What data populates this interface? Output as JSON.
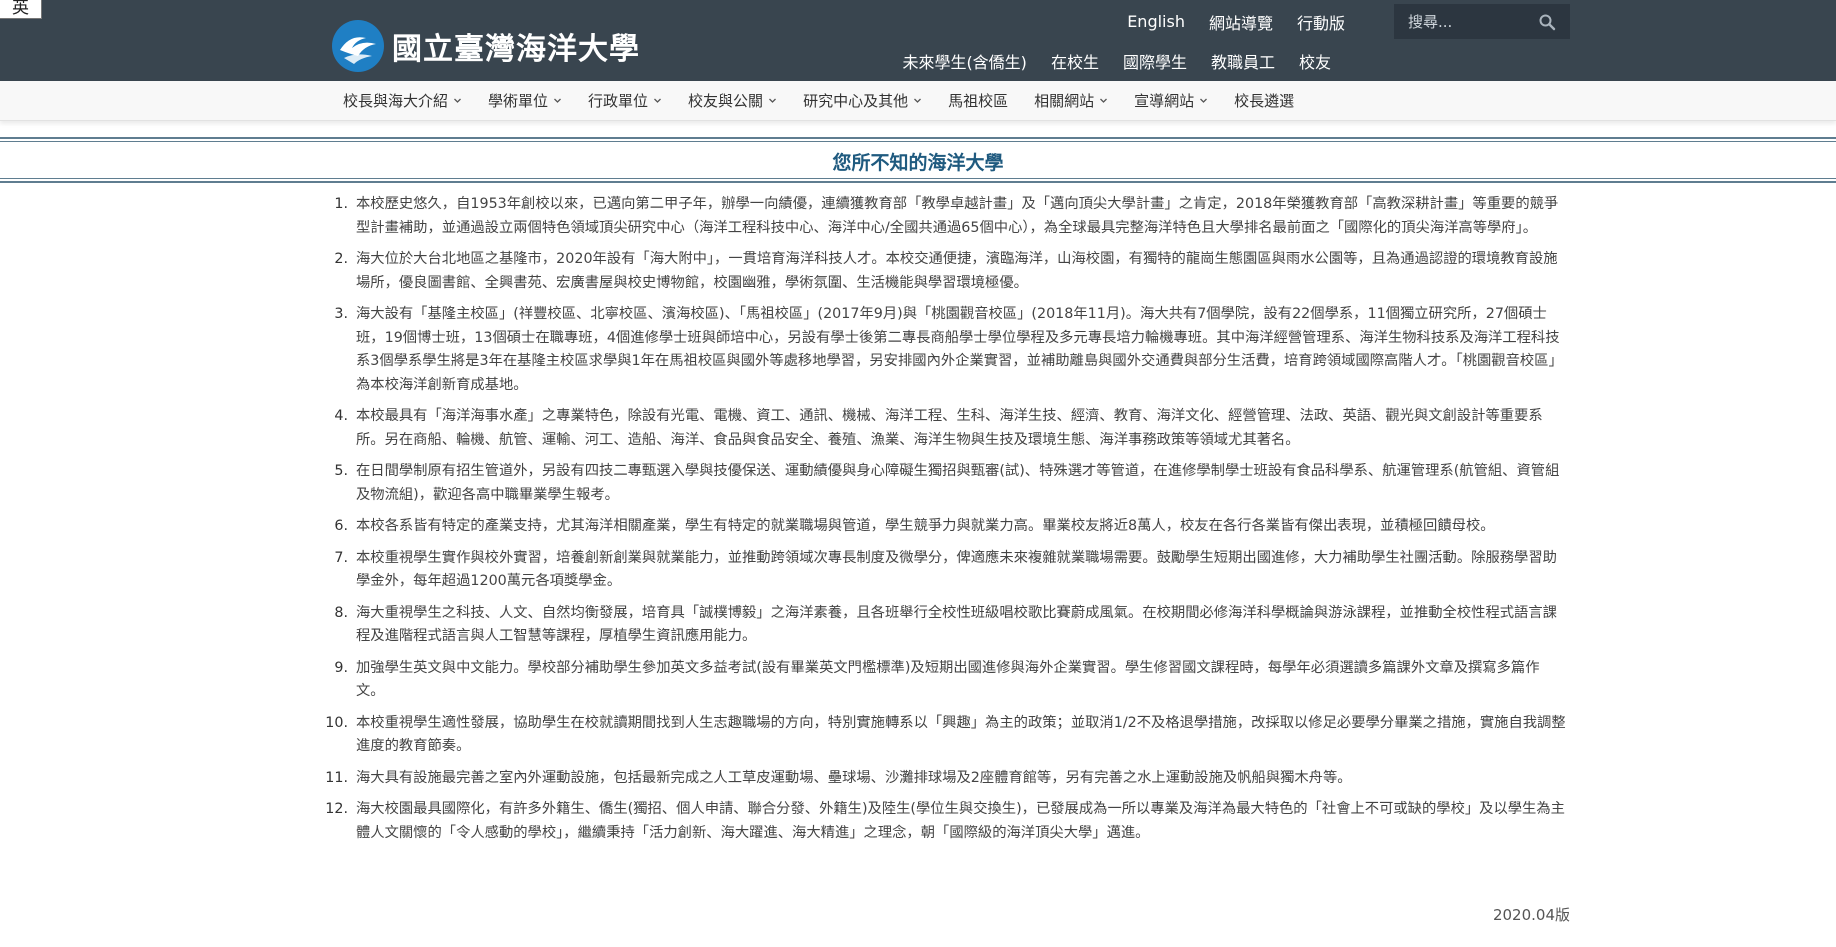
{
  "corner_badge": "英",
  "logo": {
    "text": "國立臺灣海洋大學"
  },
  "top_links": [
    "English",
    "網站導覽",
    "行動版"
  ],
  "search": {
    "placeholder": "搜尋..."
  },
  "role_links": [
    "未來學生(含僑生)",
    "在校生",
    "國際學生",
    "教職員工",
    "校友"
  ],
  "nav": [
    {
      "label": "校長與海大介紹",
      "has_dropdown": true
    },
    {
      "label": "學術單位",
      "has_dropdown": true
    },
    {
      "label": "行政單位",
      "has_dropdown": true
    },
    {
      "label": "校友與公關",
      "has_dropdown": true
    },
    {
      "label": "研究中心及其他",
      "has_dropdown": true
    },
    {
      "label": "馬祖校區",
      "has_dropdown": false
    },
    {
      "label": "相關網站",
      "has_dropdown": true
    },
    {
      "label": "宣導網站",
      "has_dropdown": true
    },
    {
      "label": "校長遴選",
      "has_dropdown": false
    }
  ],
  "page_title": "您所不知的海洋大學",
  "items": [
    {
      "num": "1.",
      "text": "本校歷史悠久，自1953年創校以來，已邁向第二甲子年，辦學一向績優，連續獲教育部「教學卓越計畫」及「邁向頂尖大學計畫」之肯定，2018年榮獲教育部「高教深耕計畫」等重要的競爭型計畫補助，並通過設立兩個特色領域頂尖研究中心（海洋工程科技中心、海洋中心/全國共通過65個中心），為全球最具完整海洋特色且大學排名最前面之「國際化的頂尖海洋高等學府」。"
    },
    {
      "num": "2.",
      "text": "海大位於大台北地區之基隆市，2020年設有「海大附中」，一貫培育海洋科技人才。本校交通便捷，濱臨海洋，山海校園，有獨特的龍崗生態園區與雨水公園等，且為通過認證的環境教育設施場所，優良圖書館、全興書苑、宏廣書屋與校史博物館，校園幽雅，學術氛圍、生活機能與學習環境極優。"
    },
    {
      "num": "3.",
      "text": "海大設有「基隆主校區」(祥豐校區、北寧校區、濱海校區)、「馬祖校區」(2017年9月)與「桃園觀音校區」(2018年11月)。海大共有7個學院，設有22個學系，11個獨立研究所，27個碩士班，19個博士班，13個碩士在職專班，4個進修學士班與師培中心，另設有學士後第二專長商船學士學位學程及多元專長培力輪機專班。其中海洋經營管理系、海洋生物科技系及海洋工程科技系3個學系學生將是3年在基隆主校區求學與1年在馬祖校區與國外等處移地學習，另安排國內外企業實習，並補助離島與國外交通費與部分生活費，培育跨領域國際高階人才。「桃園觀音校區」為本校海洋創新育成基地。"
    },
    {
      "num": "4.",
      "text": "本校最具有「海洋海事水產」之專業特色，除設有光電、電機、資工、通訊、機械、海洋工程、生科、海洋生技、經濟、教育、海洋文化、經營管理、法政、英語、觀光與文創設計等重要系所。另在商船、輪機、航管、運輸、河工、造船、海洋、食品與食品安全、養殖、漁業、海洋生物與生技及環境生態、海洋事務政策等領域尤其著名。"
    },
    {
      "num": "5.",
      "text": "在日間學制原有招生管道外，另設有四技二專甄選入學與技優保送、運動績優與身心障礙生獨招與甄審(試)、特殊選才等管道，在進修學制學士班設有食品科學系、航運管理系(航管組、資管組及物流組)，歡迎各高中職畢業學生報考。"
    },
    {
      "num": "6.",
      "text": "本校各系皆有特定的產業支持，尤其海洋相關產業，學生有特定的就業職場與管道，學生競爭力與就業力高。畢業校友將近8萬人，校友在各行各業皆有傑出表現，並積極回饋母校。"
    },
    {
      "num": "7.",
      "text": "本校重視學生實作與校外實習，培養創新創業與就業能力，並推動跨領域次專長制度及微學分，俾適應未來複雜就業職場需要。鼓勵學生短期出國進修，大力補助學生社團活動。除服務學習助學金外，每年超過1200萬元各項獎學金。"
    },
    {
      "num": "8.",
      "text": "海大重視學生之科技、人文、自然均衡發展，培育具「誠樸博毅」之海洋素養，且各班舉行全校性班級唱校歌比賽蔚成風氣。在校期間必修海洋科學概論與游泳課程，並推動全校性程式語言課程及進階程式語言與人工智慧等課程，厚植學生資訊應用能力。"
    },
    {
      "num": "9.",
      "text": "加強學生英文與中文能力。學校部分補助學生參加英文多益考試(設有畢業英文門檻標準)及短期出國進修與海外企業實習。學生修習國文課程時，每學年必須選讀多篇課外文章及撰寫多篇作文。"
    },
    {
      "num": "10.",
      "text": "本校重視學生適性發展，協助學生在校就讀期間找到人生志趣職場的方向，特別實施轉系以「興趣」為主的政策；並取消1/2不及格退學措施，改採取以修足必要學分畢業之措施，實施自我調整進度的教育節奏。"
    },
    {
      "num": "11.",
      "text": "海大具有設施最完善之室內外運動設施，包括最新完成之人工草皮運動場、壘球場、沙灘排球場及2座體育館等，另有完善之水上運動設施及帆船與獨木舟等。"
    },
    {
      "num": "12.",
      "text": "海大校園最具國際化，有許多外籍生、僑生(獨招、個人申請、聯合分發、外籍生)及陸生(學位生與交換生)，已發展成為一所以專業及海洋為最大特色的「社會上不可或缺的學校」及以學生為主體人文關懷的「令人感動的學校」，繼續秉持「活力創新、海大躍進、海大精進」之理念，朝「國際級的海洋頂尖大學」邁進。"
    }
  ],
  "version": "2020.04版",
  "colors": {
    "header_bg": "#39454f",
    "title_color": "#1f5a7f",
    "band_border": "#5f7d90",
    "logo_blue": "#1f7fc4"
  }
}
